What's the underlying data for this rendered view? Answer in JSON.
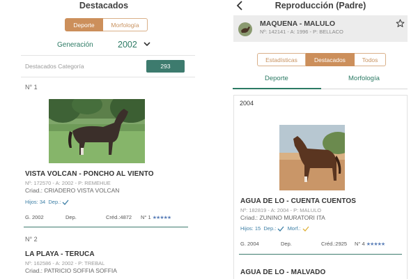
{
  "left": {
    "title": "Destacados",
    "segments": [
      "Deporte",
      "Morfología"
    ],
    "generacion_label": "Generación",
    "generacion_value": "2002",
    "categoria_label": "Destacados Categoría",
    "categoria_count": "293",
    "items": [
      {
        "number": "N° 1",
        "name": "VISTA VOLCAN - PONCHO AL VIENTO",
        "reg": "Nº: 172570 - A: 2002 - P: REMEHUE",
        "breeder": "Criad.: CRIADERO VISTA VOLCAN",
        "hijos": "Hijos: 34",
        "dep": "Dep.:",
        "gen": "G. 2002",
        "dep_col": "Dep.",
        "cred": "Créd.:4872",
        "rank": "N° 1",
        "stars": "★★★★★"
      },
      {
        "number": "N° 2",
        "name": "LA PLAYA - TERUCA",
        "reg": "Nº: 162586 - A: 2002 - P: TREBAL",
        "breeder": "Criad.: PATRICIO SOFFIA SOFFIA"
      }
    ]
  },
  "right": {
    "title": "Reproducción (Padre)",
    "horse_name": "MAQUENA - MALULO",
    "horse_reg": "Nº: 142141 - A: 1996 - P: BELLACO",
    "segments": [
      "Estadísticas",
      "Destacados",
      "Todos"
    ],
    "tabs": [
      "Deporte",
      "Morfología"
    ],
    "year": "2004",
    "items": [
      {
        "name": "AGUA DE LO - CUENTA CUENTOS",
        "reg": "Nº: 182819 - A: 2004 - P: MALULO",
        "breeder": "Criad.: ZUNINO MURATORI ITA",
        "hijos": "Hijos: 15",
        "dep": "Dep.:",
        "morf": "Morf.:",
        "gen": "G. 2004",
        "dep_col": "Dep.",
        "cred": "Créd.:2925",
        "rank": "N° 4",
        "stars": "★★★★★"
      },
      {
        "name": "AGUA DE LO - MALVADO"
      }
    ]
  },
  "colors": {
    "accent_green": "#2c7a64",
    "badge_green": "#3d7b6e",
    "accent_tan": "#cc8f5b",
    "check_blue": "#3d7fa6",
    "check_gold": "#e0b23a",
    "star_blue": "#5b7fb8"
  }
}
